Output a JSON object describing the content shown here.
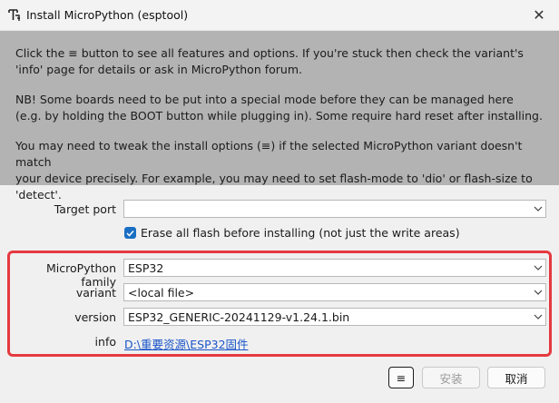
{
  "window": {
    "title": "Install MicroPython (esptool)",
    "close_glyph": "✕",
    "app_icon": "thonny-icon"
  },
  "info": {
    "p1_line1": "Click the ≡ button to see all features and options. If you're stuck then check the variant's",
    "p1_line2": "'info' page for details or ask in MicroPython forum.",
    "p2_line1": "NB! Some boards need to be put into a special mode before they can be managed here",
    "p2_line2": "(e.g. by holding the BOOT button while plugging in). Some require hard reset after installing.",
    "p3_line1": "You may need to tweak the install options (≡) if the selected MicroPython variant doesn't match",
    "p3_line2": "your device precisely. For example, you may need to set flash-mode to 'dio' or flash-size to 'detect'."
  },
  "form": {
    "target_port_label": "Target port",
    "target_port_value": "",
    "erase_label": "Erase all flash before installing (not just the write areas)",
    "erase_checked": true,
    "family_label": "MicroPython family",
    "family_value": "ESP32",
    "variant_label": "variant",
    "variant_value": "<local file>",
    "version_label": "version",
    "version_value": "ESP32_GENERIC-20241129-v1.24.1.bin",
    "info_label": "info",
    "info_link": "D:\\重要资源\\ESP32固件"
  },
  "buttons": {
    "menu": "≡",
    "install": "安装",
    "cancel": "取消"
  },
  "colors": {
    "info_bg": "#b3b3b3",
    "highlight_frame": "#e53940",
    "checkbox": "#1a6fc4",
    "link": "#1a55c9"
  }
}
